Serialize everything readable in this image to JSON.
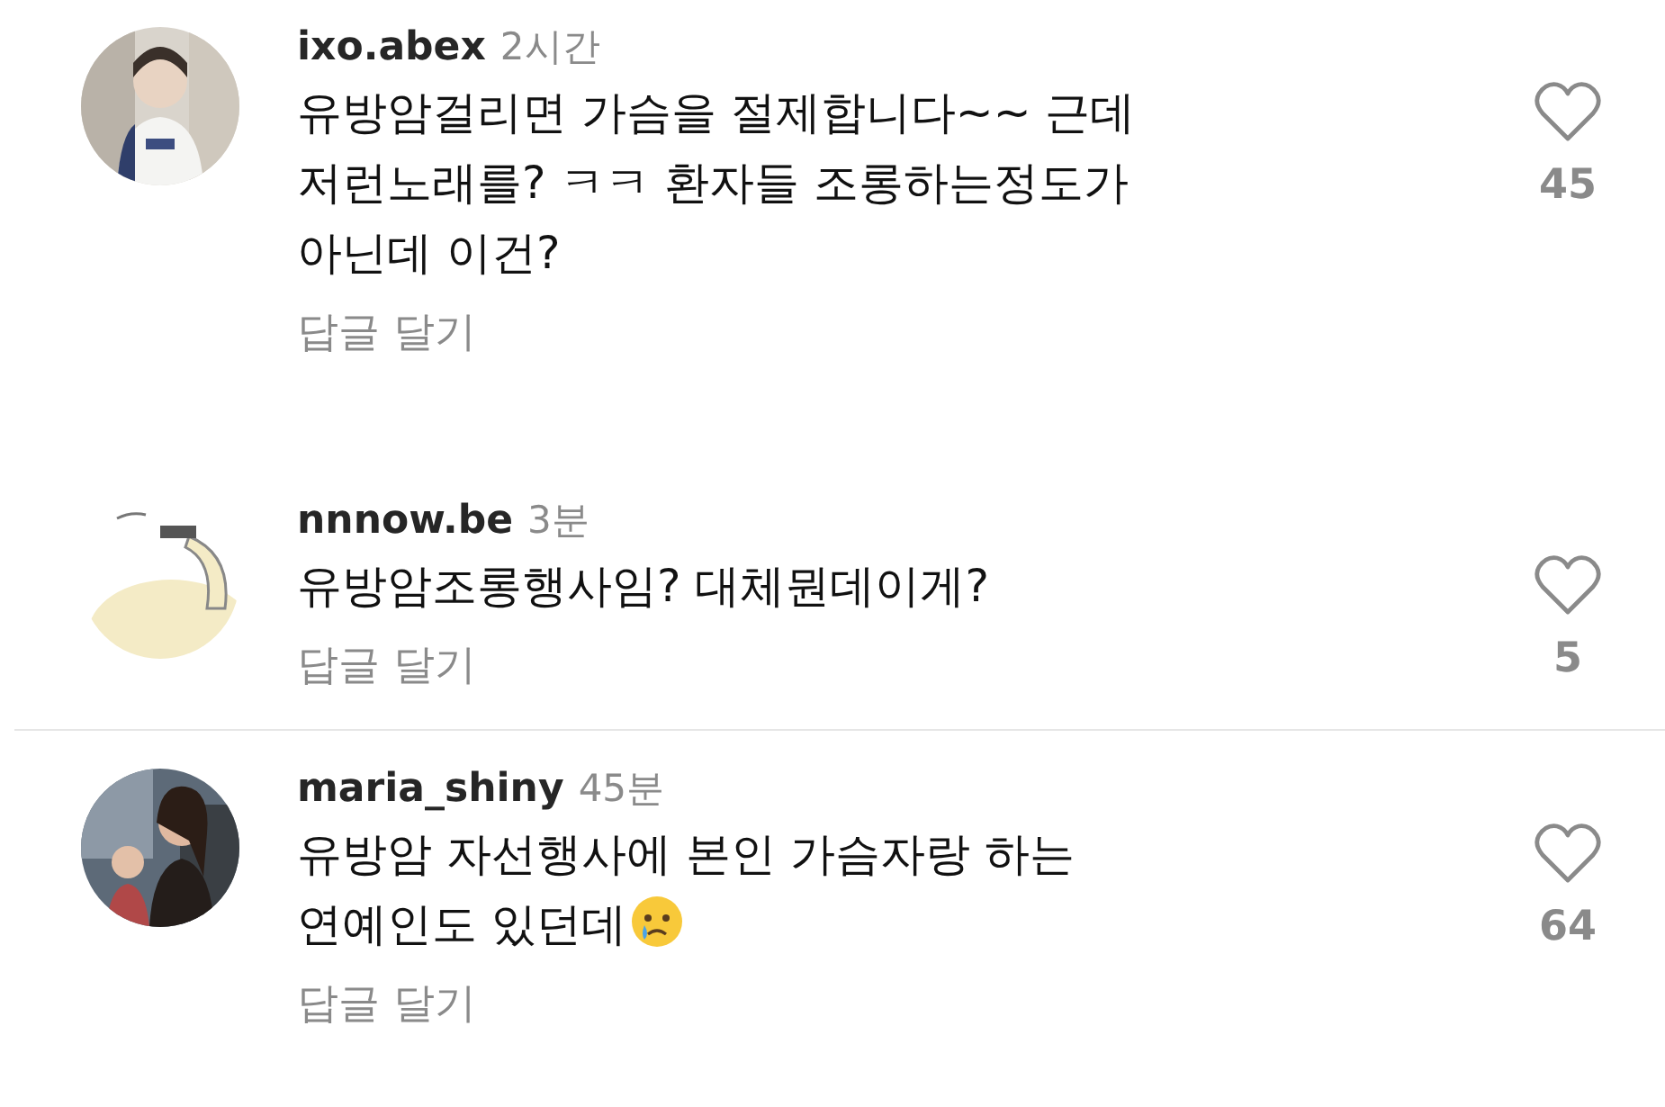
{
  "comments": [
    {
      "username": "ixo.abex",
      "time": "2시간",
      "lines": [
        "유방암걸리면 가슴을 절제합니다~~ 근데",
        "저런노래를? ㅋㅋ 환자들 조롱하는정도가",
        "아닌데 이건?"
      ],
      "emoji": false,
      "reply": "답글 달기",
      "likes": "45",
      "liked": false,
      "divider_above": false
    },
    {
      "username": "nnnow.be",
      "time": "3분",
      "lines": [
        "유방암조롱행사임? 대체뭔데이게?"
      ],
      "emoji": false,
      "reply": "답글 달기",
      "likes": "5",
      "liked": false,
      "divider_above": false
    },
    {
      "username": "maria_shiny",
      "time": "45분",
      "lines": [
        "유방암 자선행사에 본인 가슴자랑 하는",
        "연예인도 있던데"
      ],
      "emoji": true,
      "reply": "답글 달기",
      "likes": "64",
      "liked": false,
      "divider_above": true
    }
  ]
}
